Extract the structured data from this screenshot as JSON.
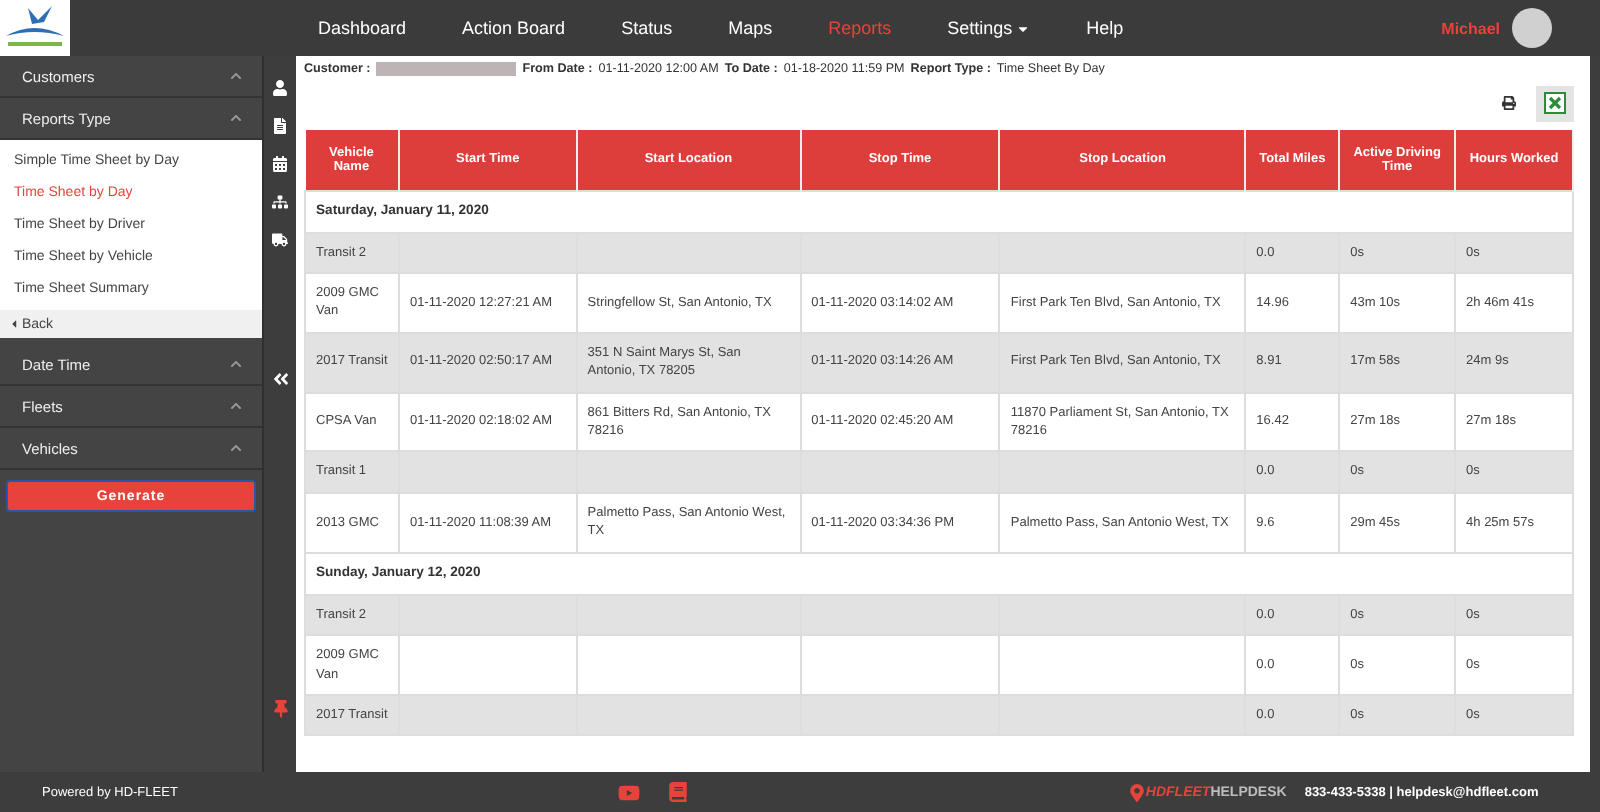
{
  "nav": {
    "items": [
      {
        "label": "Dashboard",
        "selected": false,
        "dropdown": false
      },
      {
        "label": "Action Board",
        "selected": false,
        "dropdown": false
      },
      {
        "label": "Status",
        "selected": false,
        "dropdown": false
      },
      {
        "label": "Maps",
        "selected": false,
        "dropdown": false
      },
      {
        "label": "Reports",
        "selected": true,
        "dropdown": false
      },
      {
        "label": "Settings",
        "selected": false,
        "dropdown": true
      },
      {
        "label": "Help",
        "selected": false,
        "dropdown": false
      }
    ],
    "user": "Michael"
  },
  "sidebar": {
    "sections": [
      {
        "label": "Customers",
        "expanded": true
      },
      {
        "label": "Reports Type",
        "expanded": true,
        "items": [
          {
            "label": "Simple Time Sheet by Day",
            "selected": false
          },
          {
            "label": "Time Sheet by Day",
            "selected": true
          },
          {
            "label": "Time Sheet by Driver",
            "selected": false
          },
          {
            "label": "Time Sheet by Vehicle",
            "selected": false
          },
          {
            "label": "Time Sheet Summary",
            "selected": false
          }
        ],
        "back": "Back"
      },
      {
        "label": "Date Time",
        "expanded": true
      },
      {
        "label": "Fleets",
        "expanded": true
      },
      {
        "label": "Vehicles",
        "expanded": true
      }
    ],
    "generate": "Generate"
  },
  "customer": {
    "label": "Customer :",
    "redacted": true
  },
  "filters": [
    {
      "label": "From Date :",
      "value": "01-11-2020 12:00 AM"
    },
    {
      "label": "To Date :",
      "value": "01-18-2020 11:59 PM"
    },
    {
      "label": "Report Type :",
      "value": "Time Sheet By Day"
    }
  ],
  "table": {
    "columns": [
      "Vehicle Name",
      "Start Time",
      "Start Location",
      "Stop Time",
      "Stop Location",
      "Total Miles",
      "Active Driving Time",
      "Hours Worked"
    ],
    "groups": [
      {
        "title": "Saturday, January 11, 2020",
        "rows": [
          [
            "Transit 2",
            "",
            "",
            "",
            "",
            "0.0",
            "0s",
            "0s"
          ],
          [
            "2009 GMC Van",
            "01-11-2020 12:27:21 AM",
            "Stringfellow St, San Antonio, TX",
            "01-11-2020 03:14:02 AM",
            "First Park Ten Blvd, San Antonio, TX",
            "14.96",
            "43m 10s",
            "2h 46m 41s"
          ],
          [
            "2017 Transit",
            "01-11-2020 02:50:17 AM",
            "351 N Saint Marys St, San Antonio, TX 78205",
            "01-11-2020 03:14:26 AM",
            "First Park Ten Blvd, San Antonio, TX",
            "8.91",
            "17m 58s",
            "24m 9s"
          ],
          [
            "CPSA Van",
            "01-11-2020 02:18:02 AM",
            "861 Bitters Rd, San Antonio, TX 78216",
            "01-11-2020 02:45:20 AM",
            "11870 Parliament St, San Antonio, TX 78216",
            "16.42",
            "27m 18s",
            "27m 18s"
          ],
          [
            "Transit 1",
            "",
            "",
            "",
            "",
            "0.0",
            "0s",
            "0s"
          ],
          [
            "2013 GMC",
            "01-11-2020 11:08:39 AM",
            "Palmetto Pass, San Antonio West, TX",
            "01-11-2020 03:34:36 PM",
            "Palmetto Pass, San Antonio West, TX",
            "9.6",
            "29m 45s",
            "4h 25m 57s"
          ]
        ]
      },
      {
        "title": "Sunday, January 12, 2020",
        "rows": [
          [
            "Transit 2",
            "",
            "",
            "",
            "",
            "0.0",
            "0s",
            "0s"
          ],
          [
            "2009 GMC Van",
            "",
            "",
            "",
            "",
            "0.0",
            "0s",
            "0s"
          ],
          [
            "2017 Transit",
            "",
            "",
            "",
            "",
            "0.0",
            "0s",
            "0s"
          ]
        ]
      }
    ]
  },
  "footer": {
    "powered": "Powered by HD-FLEET",
    "helpdesk_brand": "HDFLEET",
    "helpdesk_word": "HELPDESK",
    "contact": "833-433-5338 | helpdesk@hdfleet.com"
  }
}
